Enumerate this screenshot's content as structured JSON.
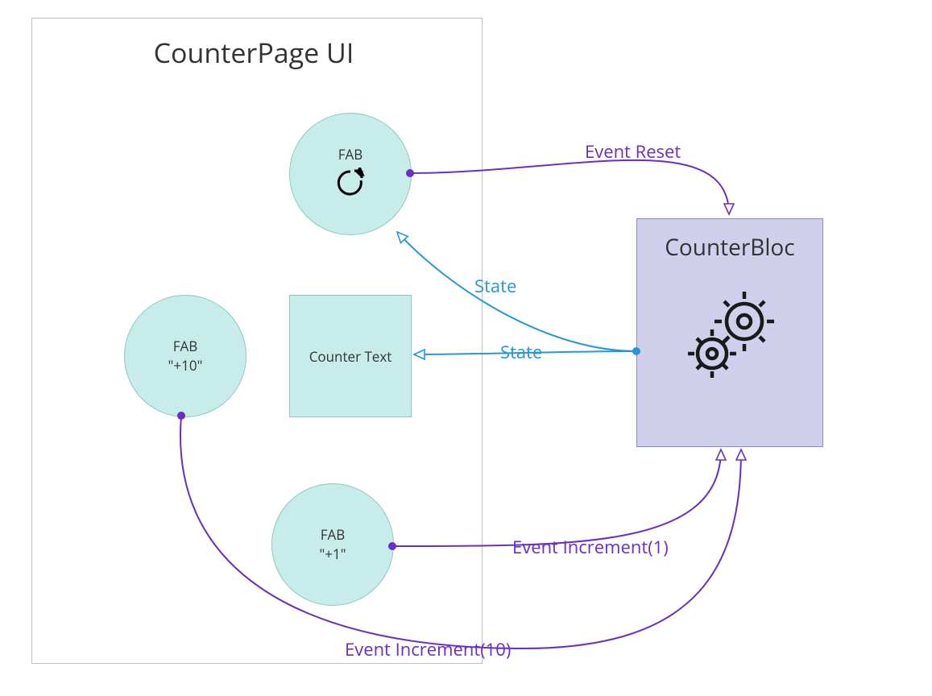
{
  "container": {
    "title": "CounterPage UI"
  },
  "bloc": {
    "title": "CounterBloc"
  },
  "nodes": {
    "fab_reset": {
      "label": "FAB",
      "icon_name": "reset-icon"
    },
    "fab_plus10": {
      "label1": "FAB",
      "label2": "\"+10\""
    },
    "fab_plus1": {
      "label1": "FAB",
      "label2": "\"+1\""
    },
    "counter_text": {
      "label": "Counter Text"
    }
  },
  "edges": {
    "event_reset": {
      "label": "Event Reset"
    },
    "event_increment1": {
      "label": "Event Increment(1)"
    },
    "event_increment10": {
      "label": "Event Increment(10)"
    },
    "state_to_reset": {
      "label": "State"
    },
    "state_to_text": {
      "label": "State"
    }
  }
}
